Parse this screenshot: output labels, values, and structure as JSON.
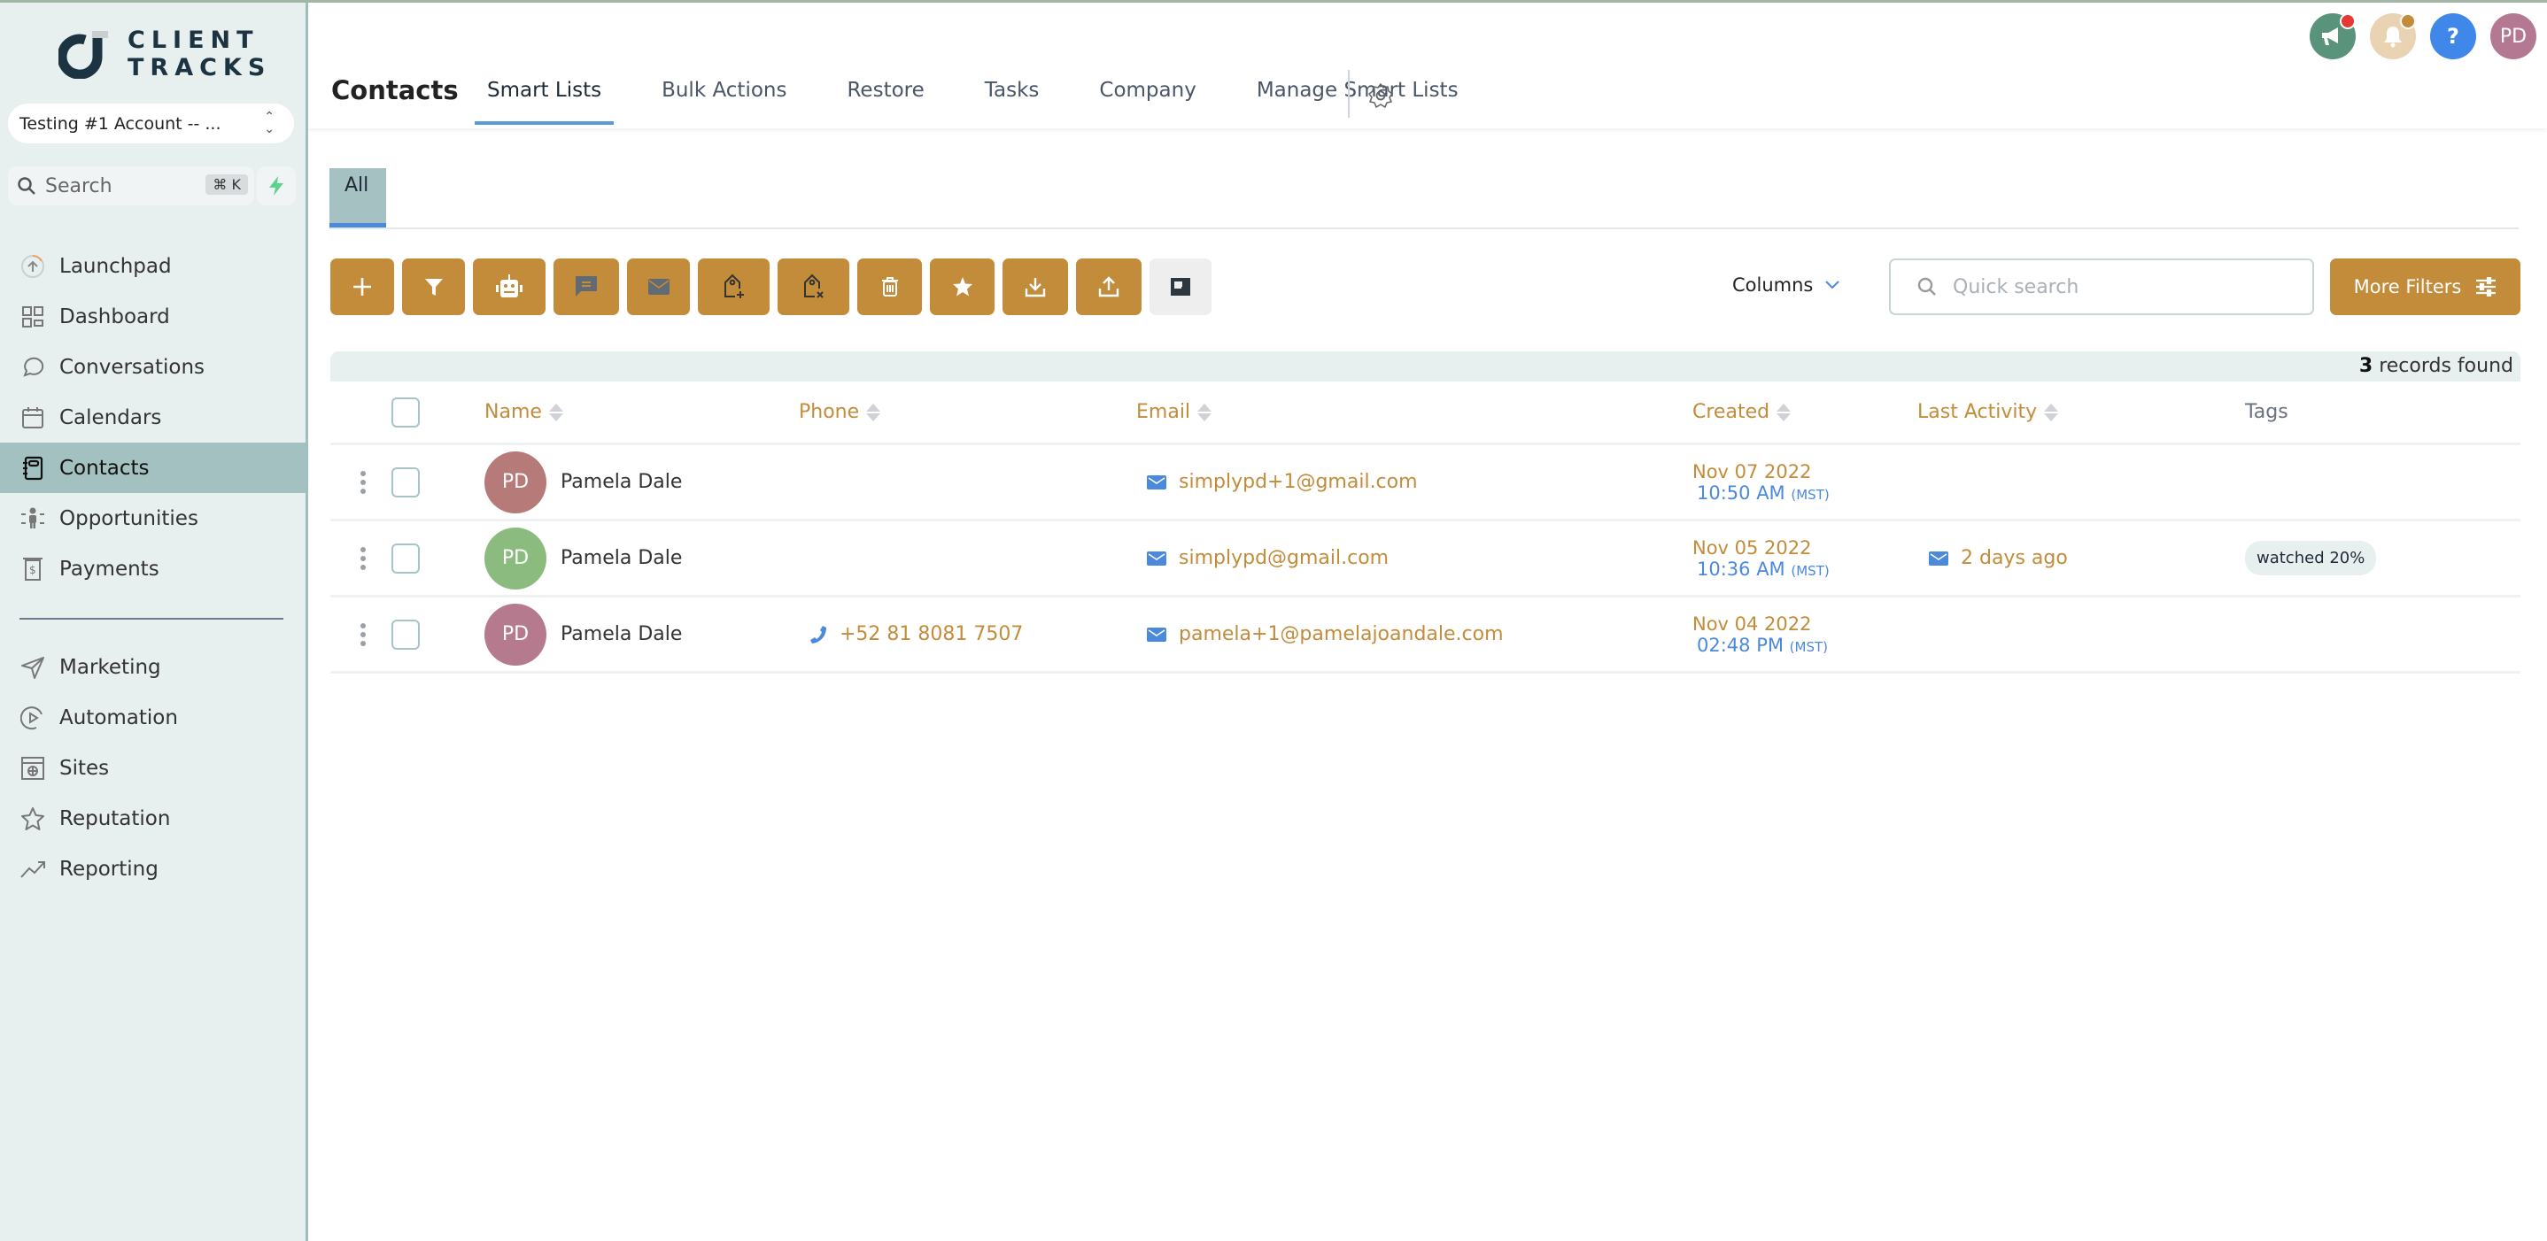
{
  "app": {
    "logo_line1": "CLIENT",
    "logo_line2": "TRACKS",
    "account_selector": "Testing #1 Account -- ...",
    "search_placeholder": "Search",
    "search_shortcut": "⌘ K"
  },
  "sidebar": {
    "items": [
      {
        "label": "Launchpad",
        "icon": "launchpad-icon"
      },
      {
        "label": "Dashboard",
        "icon": "dashboard-icon"
      },
      {
        "label": "Conversations",
        "icon": "chat-bubble-icon"
      },
      {
        "label": "Calendars",
        "icon": "calendar-icon"
      },
      {
        "label": "Contacts",
        "icon": "contacts-book-icon",
        "active": true
      },
      {
        "label": "Opportunities",
        "icon": "opportunities-icon"
      },
      {
        "label": "Payments",
        "icon": "payments-icon"
      }
    ],
    "items2": [
      {
        "label": "Marketing",
        "icon": "send-icon"
      },
      {
        "label": "Automation",
        "icon": "automation-play-icon"
      },
      {
        "label": "Sites",
        "icon": "sites-globe-icon"
      },
      {
        "label": "Reputation",
        "icon": "star-icon"
      },
      {
        "label": "Reporting",
        "icon": "trend-chart-icon"
      }
    ]
  },
  "header": {
    "title": "Contacts",
    "tabs": [
      "Smart Lists",
      "Bulk Actions",
      "Restore",
      "Tasks",
      "Company",
      "Manage Smart Lists"
    ],
    "active_tab": "Smart Lists",
    "user_initials": "PD"
  },
  "smart_list": {
    "tabs": [
      "All"
    ],
    "active": "All"
  },
  "toolbar": {
    "buttons": [
      "add-contact",
      "filter",
      "automation-bot",
      "send-sms",
      "send-email",
      "add-tag",
      "remove-tag",
      "delete",
      "review-request",
      "import",
      "export",
      "merge"
    ],
    "columns_label": "Columns",
    "quick_search_placeholder": "Quick search",
    "more_filters_label": "More Filters"
  },
  "table": {
    "records_count": "3",
    "records_label": "records found",
    "columns": [
      "Name",
      "Phone",
      "Email",
      "Created",
      "Last Activity",
      "Tags"
    ],
    "rows": [
      {
        "initials": "PD",
        "avatar_color": "#b67a78",
        "name": "Pamela Dale",
        "phone": "",
        "email": "simplypd+1@gmail.com",
        "created_date": "Nov 07 2022",
        "created_time": "10:50 AM",
        "timezone": "(MST)",
        "last_activity": "",
        "tag": ""
      },
      {
        "initials": "PD",
        "avatar_color": "#8bbb7e",
        "name": "Pamela Dale",
        "phone": "",
        "email": "simplypd@gmail.com",
        "created_date": "Nov 05 2022",
        "created_time": "10:36 AM",
        "timezone": "(MST)",
        "last_activity": "2 days ago",
        "tag": "watched 20%"
      },
      {
        "initials": "PD",
        "avatar_color": "#b67a8e",
        "name": "Pamela Dale",
        "phone": "+52 81 8081 7507",
        "email": "pamela+1@pamelajoandale.com",
        "created_date": "Nov 04 2022",
        "created_time": "02:48 PM",
        "timezone": "(MST)",
        "last_activity": "",
        "tag": ""
      }
    ]
  },
  "colors": {
    "accent": "#c28c3a",
    "link_blue": "#4a89dc",
    "sidebar_bg": "#e8f0ef",
    "sidebar_active": "#a3c1c1"
  }
}
